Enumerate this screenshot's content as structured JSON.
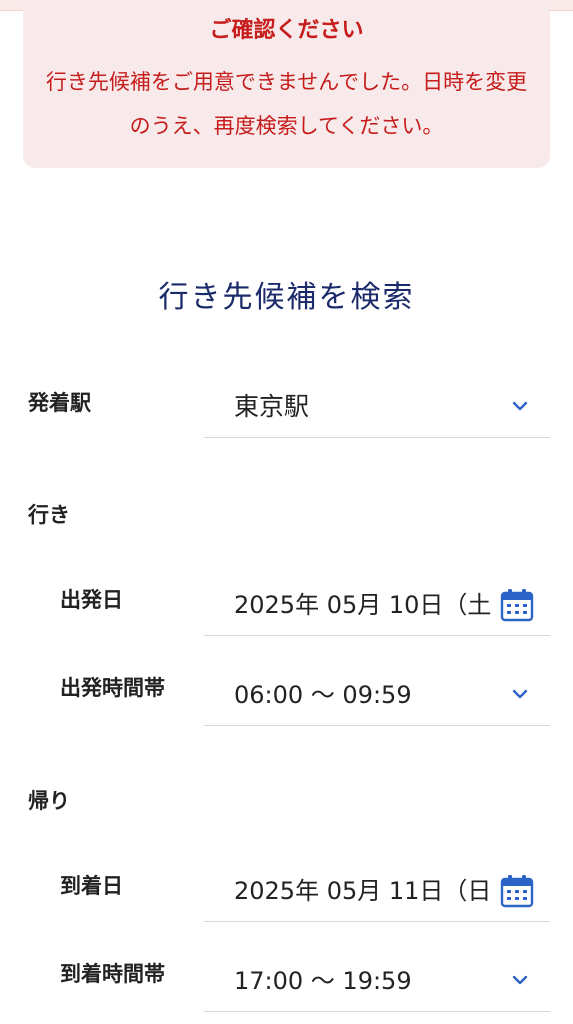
{
  "alert": {
    "title": "ご確認ください",
    "message": "行き先候補をご用意できませんでした。日時を変更のうえ、再度検索してください。"
  },
  "search": {
    "title": "行き先候補を検索"
  },
  "station": {
    "label": "発着駅",
    "value": "東京駅"
  },
  "outbound": {
    "label": "行き",
    "date_label": "出発日",
    "date_value": "2025年 05月 10日（土",
    "time_label": "出発時間帯",
    "time_value": "06:00 〜 09:59"
  },
  "return": {
    "label": "帰り",
    "date_label": "到着日",
    "date_value": "2025年 05月 11日（日",
    "time_label": "到着時間帯",
    "time_value": "17:00 〜 19:59"
  },
  "colors": {
    "alert_text": "#c61c1c",
    "alert_bg": "#f8eaea",
    "title_navy": "#1b2a6b",
    "accent_blue": "#2b63c6"
  },
  "icons": {
    "select": "chevron-down-icon",
    "date": "calendar-icon"
  }
}
